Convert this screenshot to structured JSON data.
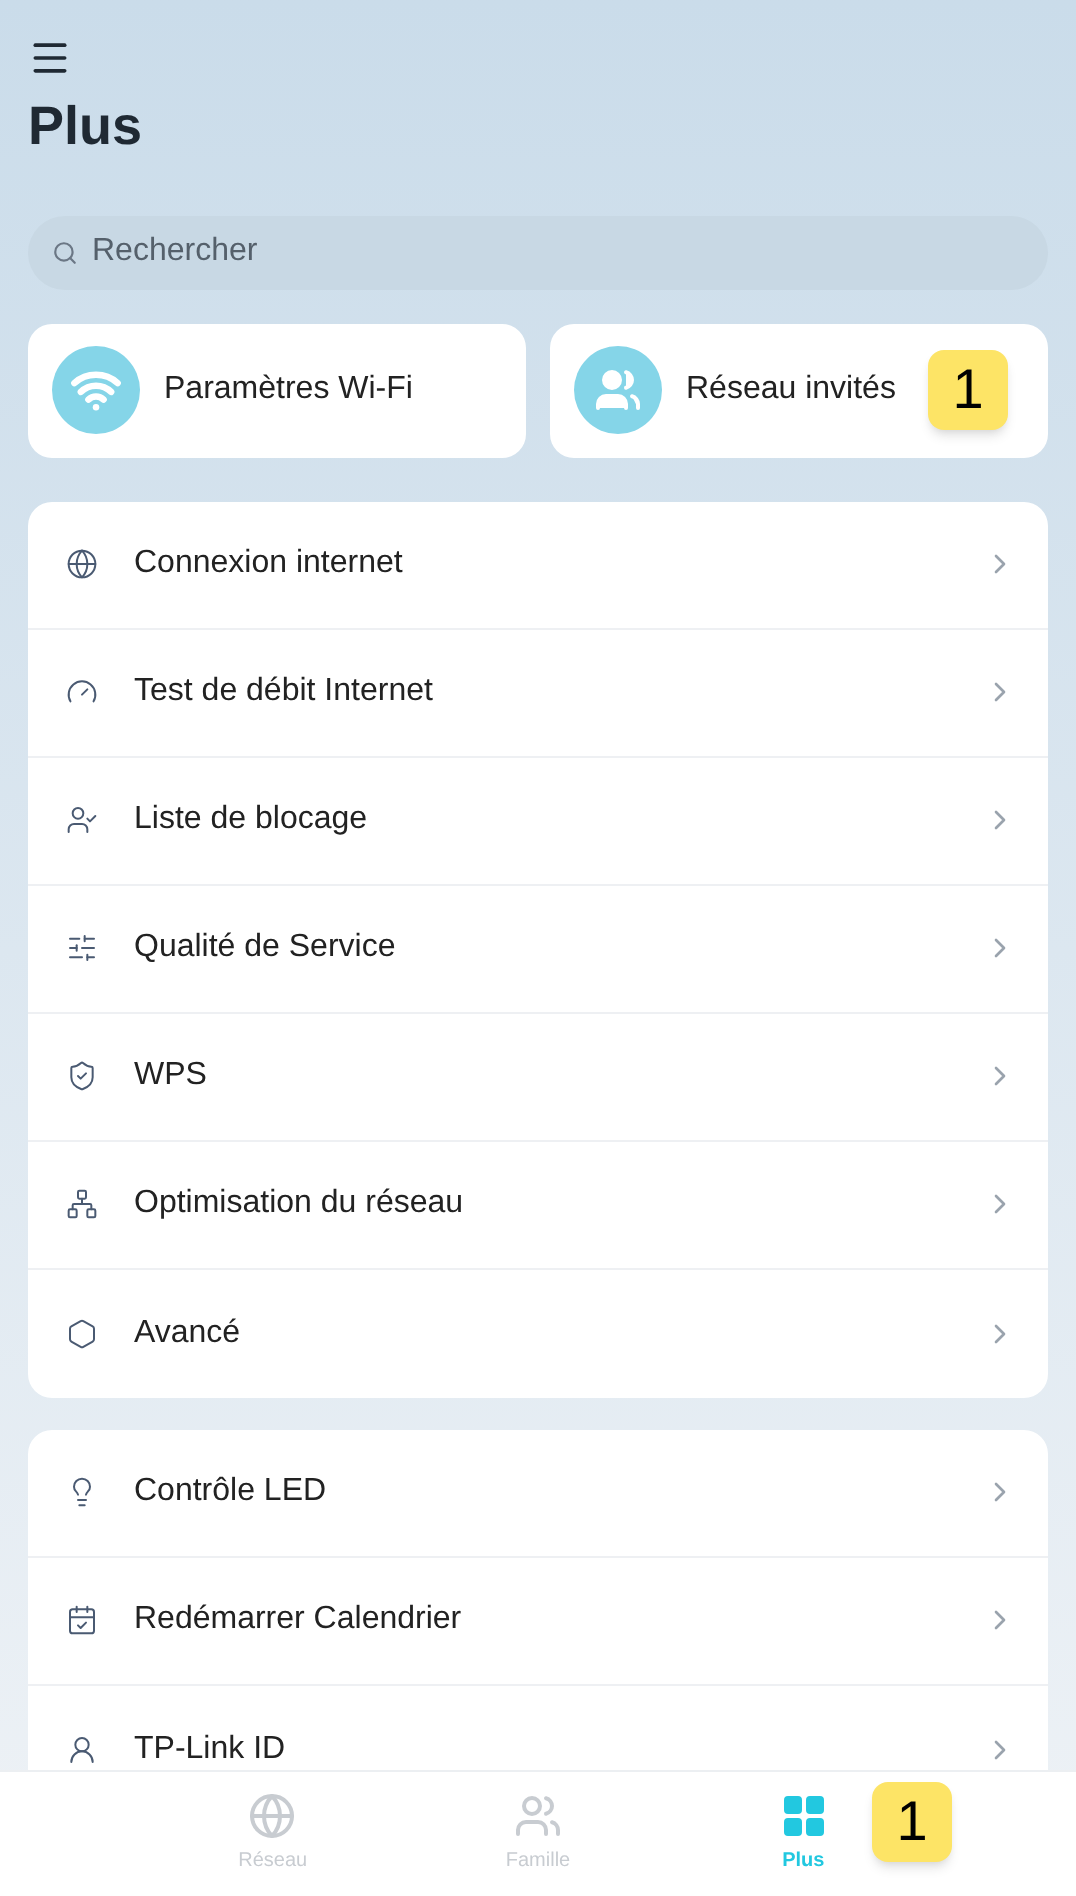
{
  "header": {
    "title": "Plus"
  },
  "search": {
    "placeholder": "Rechercher"
  },
  "quick_cards": [
    {
      "kind": "wifi",
      "label": "Paramètres Wi-Fi"
    },
    {
      "kind": "guests",
      "label": "Réseau invités",
      "badge": "1"
    }
  ],
  "menu_groups": [
    [
      {
        "kind": "globe",
        "label": "Connexion internet"
      },
      {
        "kind": "gauge",
        "label": "Test de débit Internet"
      },
      {
        "kind": "user",
        "label": "Liste de blocage"
      },
      {
        "kind": "sliders",
        "label": "Qualité de Service"
      },
      {
        "kind": "shield",
        "label": "WPS"
      },
      {
        "kind": "network",
        "label": "Optimisation du réseau"
      },
      {
        "kind": "hexagon",
        "label": "Avancé"
      }
    ],
    [
      {
        "kind": "led",
        "label": "Contrôle LED"
      },
      {
        "kind": "calendar",
        "label": "Redémarrer Calendrier"
      },
      {
        "kind": "id",
        "label": "TP-Link ID"
      }
    ]
  ],
  "bottom_nav": [
    {
      "kind": "globe",
      "label": "Réseau",
      "selected": false
    },
    {
      "kind": "family",
      "label": "Famille",
      "selected": false
    },
    {
      "kind": "grid",
      "label": "Plus",
      "selected": true,
      "badge": "1"
    }
  ]
}
